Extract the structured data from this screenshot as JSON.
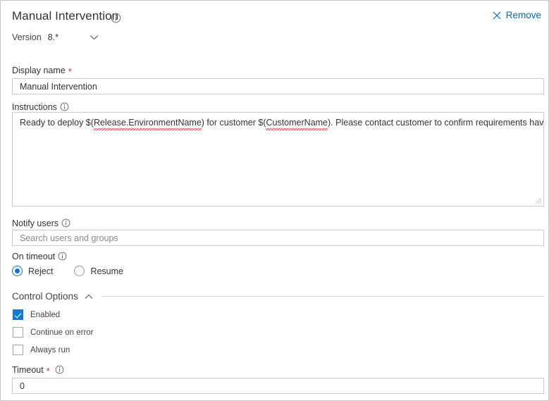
{
  "header": {
    "title": "Manual Intervention",
    "info_icon": "info-icon",
    "remove_label": "Remove",
    "remove_icon": "close-x-icon"
  },
  "version": {
    "label": "Version",
    "value": "8.*",
    "chevron_icon": "chevron-down-icon"
  },
  "display_name": {
    "label": "Display name",
    "required_marker": "*",
    "value": "Manual Intervention"
  },
  "instructions": {
    "label": "Instructions",
    "info_icon": "info-icon",
    "text_parts": [
      {
        "text": "Ready to deploy $(",
        "spell": false
      },
      {
        "text": "Release.EnvironmentName",
        "spell": true
      },
      {
        "text": ") for customer $(",
        "spell": false
      },
      {
        "text": "CustomerName",
        "spell": true
      },
      {
        "text": "). Please contact customer to confirm requirements have been met.",
        "spell": false
      }
    ],
    "full_text": "Ready to deploy $(Release.EnvironmentName) for customer $(CustomerName). Please contact customer to confirm requirements have been met.",
    "resize_handle": "resize-grip-icon"
  },
  "notify_users": {
    "label": "Notify users",
    "info_icon": "info-icon",
    "value": "",
    "placeholder": "Search users and groups"
  },
  "on_timeout": {
    "label": "On timeout",
    "info_icon": "info-icon",
    "options": [
      {
        "label": "Reject",
        "selected": true
      },
      {
        "label": "Resume",
        "selected": false
      }
    ]
  },
  "control_options": {
    "title": "Control Options",
    "chevron_icon": "chevron-up-icon",
    "expanded": true,
    "checkboxes": [
      {
        "label": "Enabled",
        "checked": true
      },
      {
        "label": "Continue on error",
        "checked": false
      },
      {
        "label": "Always run",
        "checked": false
      }
    ]
  },
  "timeout": {
    "label": "Timeout",
    "required_marker": "*",
    "info_icon": "info-icon",
    "value": "0"
  },
  "colors": {
    "accent": "#0078d4",
    "link": "#0066cc",
    "required": "#cc3333",
    "border": "#cccccc",
    "text": "#333333",
    "placeholder": "#8a8a8a",
    "spellcheck_underline": "#e04a4a"
  }
}
